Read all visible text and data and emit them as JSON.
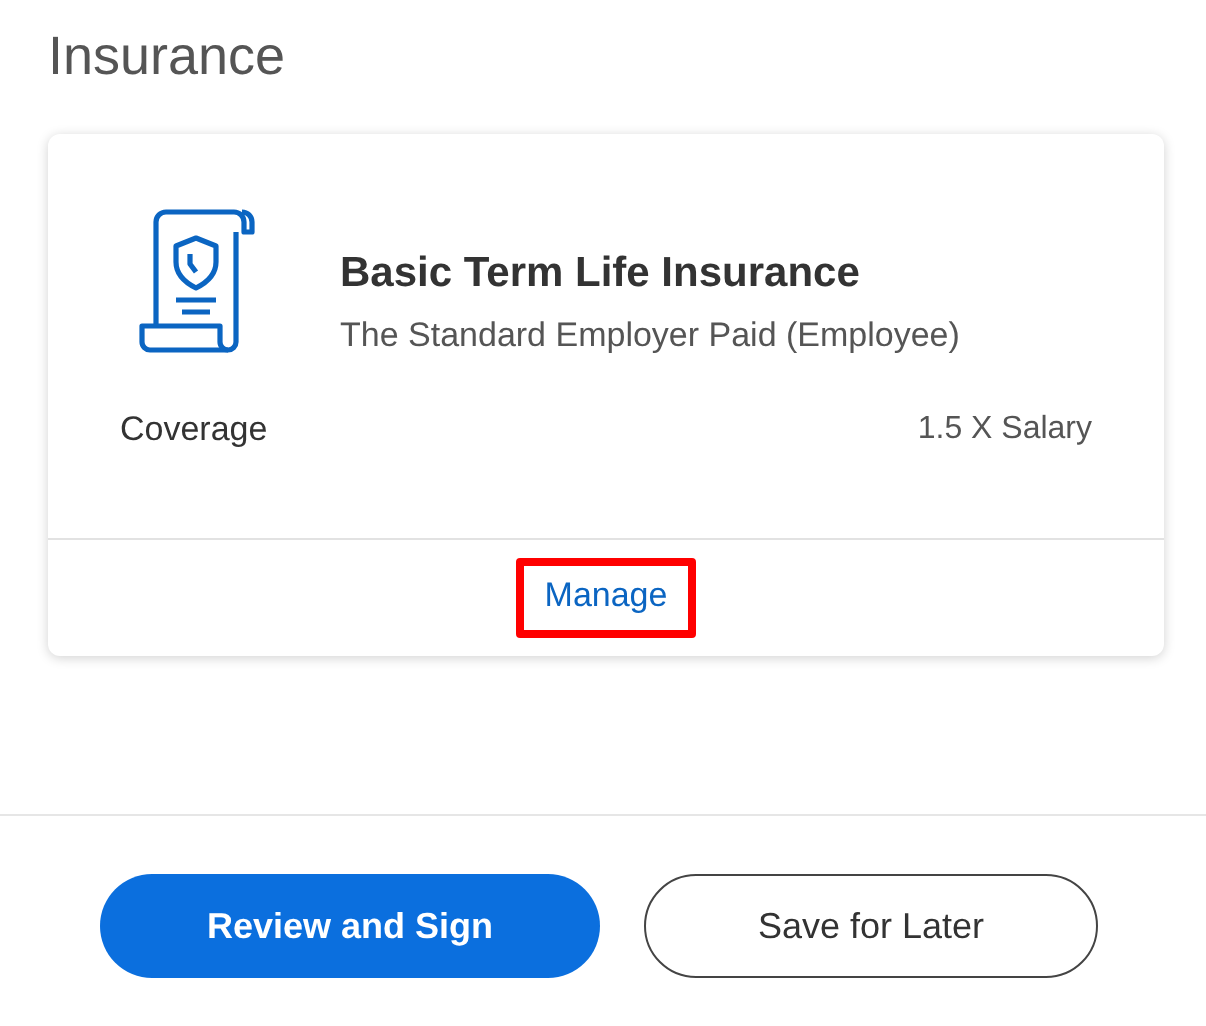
{
  "heading": "Insurance",
  "plan": {
    "name": "Basic Term Life Insurance",
    "provider": "The Standard Employer Paid (Employee)",
    "coverage_label": "Coverage",
    "coverage_value": "1.5 X Salary",
    "action": {
      "label": "Manage",
      "highlighted": true
    }
  },
  "buttons": [
    {
      "label": "Review and Sign",
      "kind": "primary"
    },
    {
      "label": "Save for Later",
      "kind": "outline"
    }
  ]
}
